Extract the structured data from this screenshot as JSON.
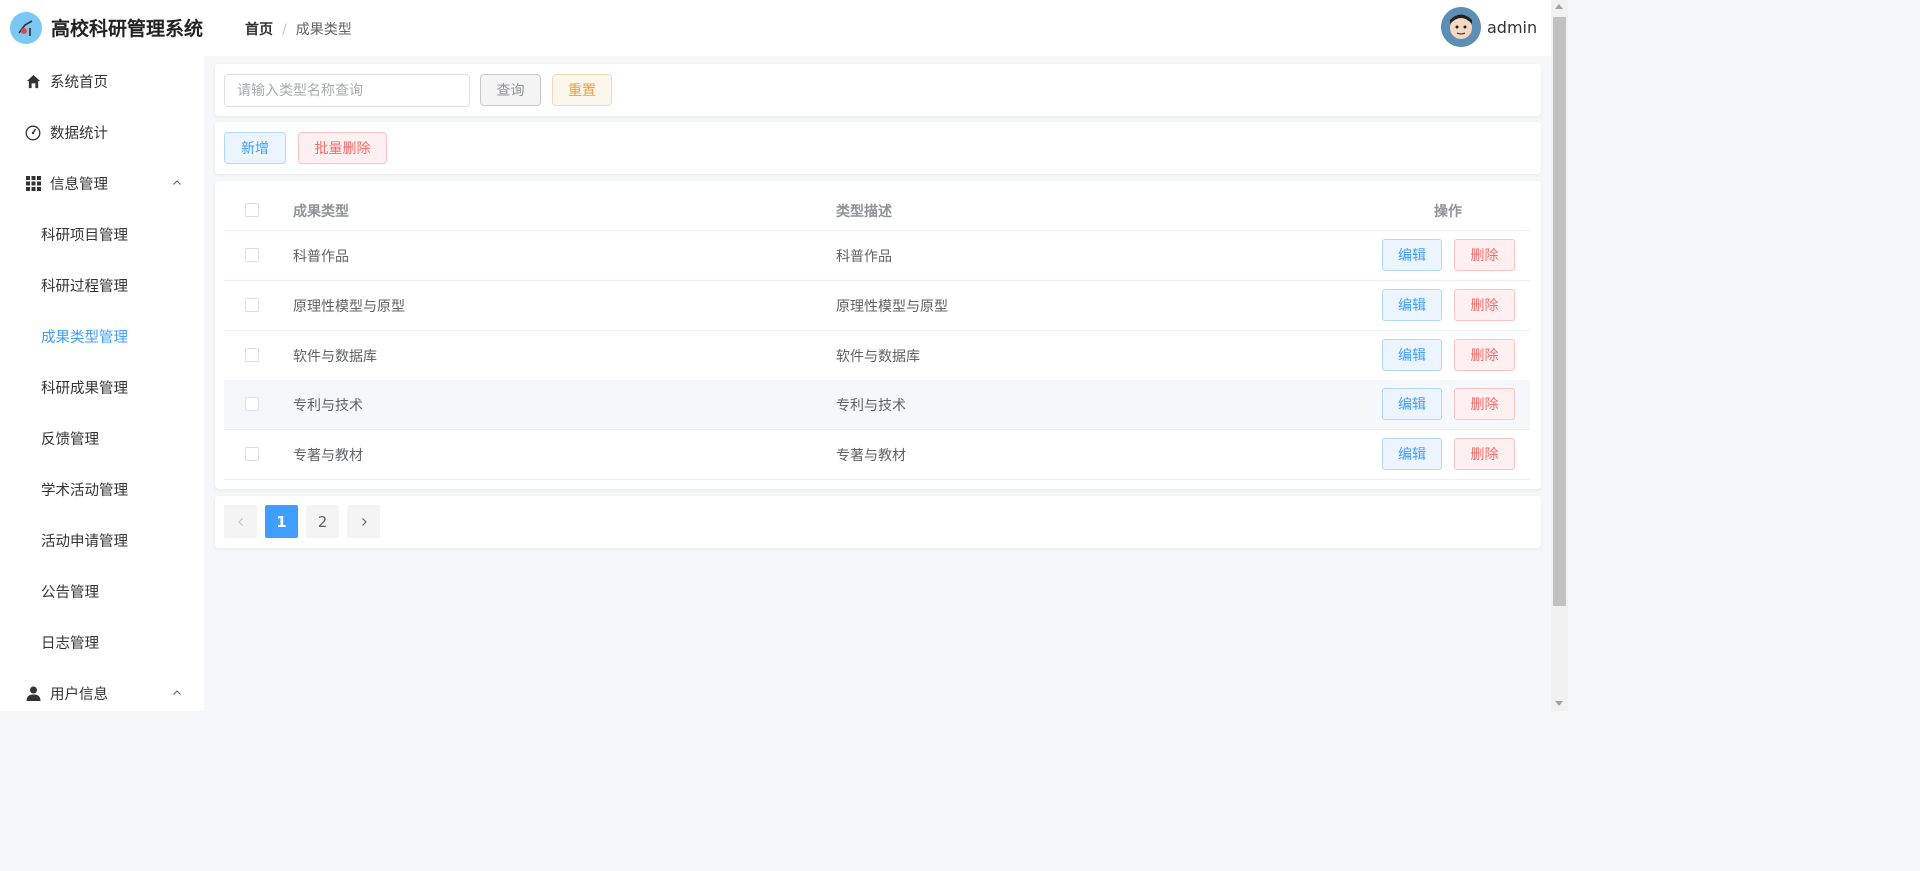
{
  "header": {
    "app_title": "高校科研管理系统",
    "breadcrumb": {
      "home": "首页",
      "separator": "/",
      "current": "成果类型"
    },
    "user": {
      "name": "admin"
    }
  },
  "sidebar": {
    "items": [
      {
        "label": "系统首页",
        "icon": "home-icon"
      },
      {
        "label": "数据统计",
        "icon": "dashboard-gauge-icon"
      },
      {
        "label": "信息管理",
        "icon": "grid-icon",
        "expanded": true
      },
      {
        "label": "科研项目管理"
      },
      {
        "label": "科研过程管理"
      },
      {
        "label": "成果类型管理",
        "active": true
      },
      {
        "label": "科研成果管理"
      },
      {
        "label": "反馈管理"
      },
      {
        "label": "学术活动管理"
      },
      {
        "label": "活动申请管理"
      },
      {
        "label": "公告管理"
      },
      {
        "label": "日志管理"
      },
      {
        "label": "用户信息",
        "icon": "user-icon",
        "expanded": true
      }
    ]
  },
  "search": {
    "placeholder": "请输入类型名称查询",
    "value": "",
    "query_label": "查询",
    "reset_label": "重置"
  },
  "toolbar": {
    "add_label": "新增",
    "batch_delete_label": "批量删除"
  },
  "table": {
    "columns": [
      "成果类型",
      "类型描述",
      "操作"
    ],
    "rows": [
      {
        "name": "科普作品",
        "description": "科普作品"
      },
      {
        "name": "原理性模型与原型",
        "description": "原理性模型与原型"
      },
      {
        "name": "软件与数据库",
        "description": "软件与数据库"
      },
      {
        "name": "专利与技术",
        "description": "专利与技术",
        "hovered": true
      },
      {
        "name": "专著与教材",
        "description": "专著与教材"
      }
    ],
    "edit_label": "编辑",
    "delete_label": "删除"
  },
  "pagination": {
    "pages": [
      "1",
      "2"
    ],
    "current_page": 1,
    "prev_icon": "chevron-left-icon",
    "next_icon": "chevron-right-icon"
  },
  "colors": {
    "primary": "#409eff",
    "danger": "#f56c6c",
    "warning": "#e6a23c"
  }
}
